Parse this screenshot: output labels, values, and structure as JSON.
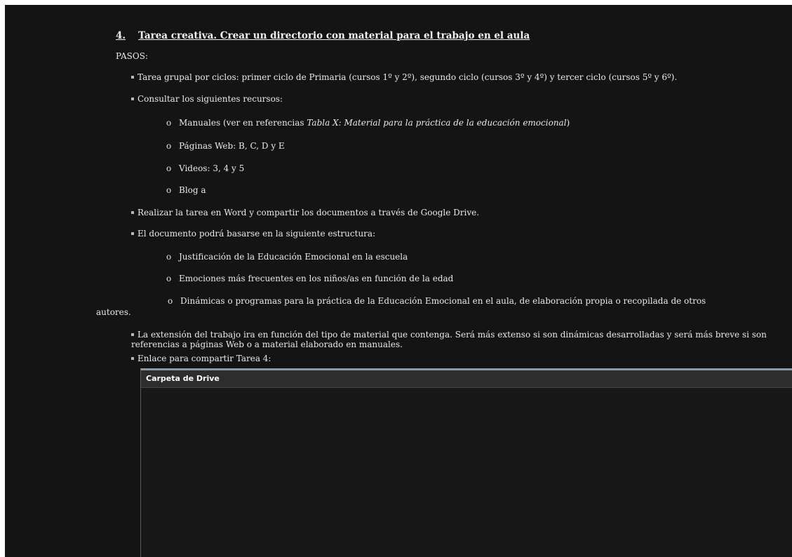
{
  "heading": {
    "number": "4.",
    "title": "Tarea creativa. Crear un directorio con material para el trabajo en el aula"
  },
  "pasos_label": "PASOS:",
  "bullets": {
    "b1": "Tarea grupal por ciclos: primer ciclo de Primaria (cursos 1º y 2º), segundo ciclo (cursos 3º y 4º) y tercer ciclo (cursos 5º y 6º).",
    "b2": "Consultar los siguientes recursos:",
    "b3": "Realizar la tarea en Word y compartir los documentos a través de Google Drive.",
    "b4": "El documento podrá basarse en la siguiente estructura:",
    "b5": "La extensión del trabajo ira en función del tipo de material que contenga. Será más extenso si son dinámicas desarrolladas y será más breve si son referencias a páginas Web o a material elaborado en manuales.",
    "b6": "Enlace para compartir Tarea 4:"
  },
  "resources": {
    "manuales_prefix": "Manuales (ver en referencias ",
    "manuales_italic": "Tabla X: Material para la práctica  de la educación emocional",
    "manuales_suffix": ")",
    "paginas": "Páginas Web: B, C, D y E",
    "videos": "Videos: 3, 4 y 5",
    "blog": "Blog a"
  },
  "structure": {
    "s1": "Justificación de la Educación Emocional en la escuela",
    "s2": "Emociones más frecuentes en los niños/as en función de la edad",
    "s3": "Dinámicas o programas para la práctica de la Educación Emocional en el aula, de elaboración propia o recopilada de otros",
    "s3_cont": "autores."
  },
  "list_marker": "o",
  "drive_panel": {
    "title": "Carpeta de Drive"
  },
  "colors": {
    "background": "#141414",
    "text": "#e9e9e9",
    "panel_border": "#8c9aa6"
  }
}
